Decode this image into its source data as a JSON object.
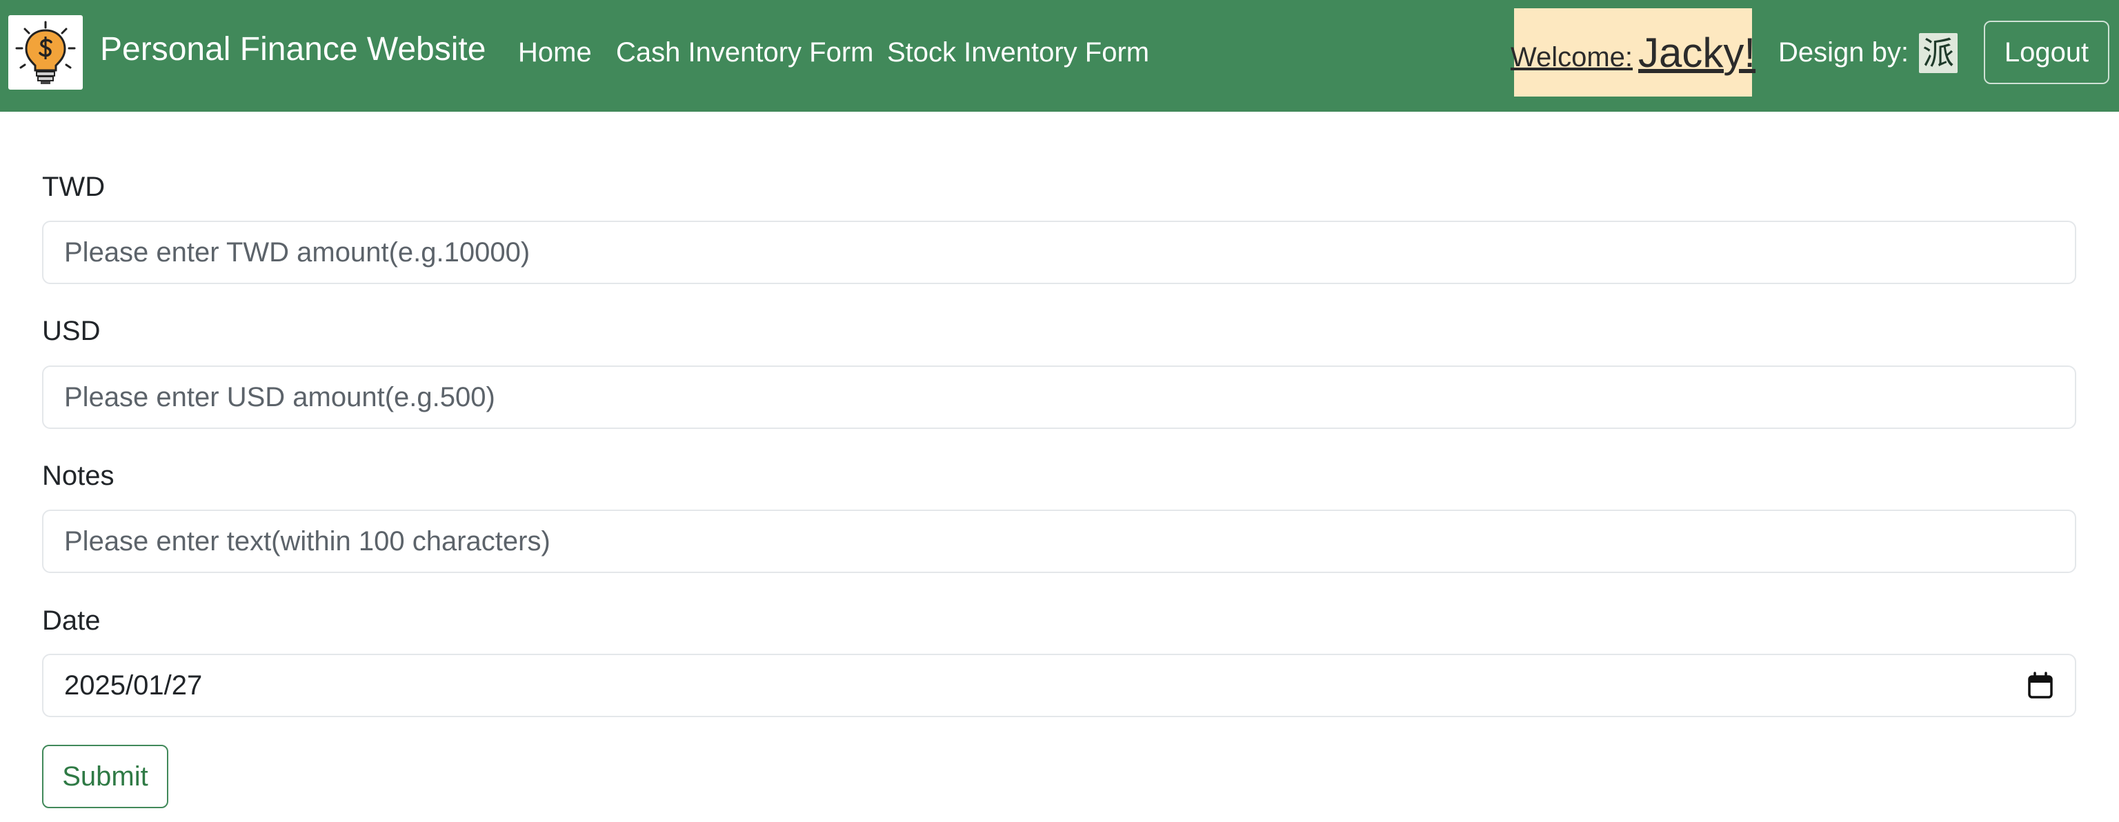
{
  "navbar": {
    "brand_title": "Personal Finance Website",
    "logo_icon": "lightbulb-dollar-icon",
    "links": {
      "home": "Home",
      "cash": "Cash Inventory Form",
      "stock": "Stock Inventory Form"
    },
    "welcome_label": "Welcome:",
    "welcome_name": "Jacky!",
    "design_by": "Design by:",
    "designer_glyph": "派",
    "logout": "Logout",
    "colors": {
      "background": "#41895a",
      "welcome_bg": "#fde8c0"
    }
  },
  "form": {
    "twd": {
      "label": "TWD",
      "placeholder": "Please enter TWD amount(e.g.10000)",
      "value": ""
    },
    "usd": {
      "label": "USD",
      "placeholder": "Please enter USD amount(e.g.500)",
      "value": ""
    },
    "notes": {
      "label": "Notes",
      "placeholder": "Please enter text(within 100 characters)",
      "value": ""
    },
    "date": {
      "label": "Date",
      "value": "2025/01/27",
      "icon": "calendar-icon"
    },
    "submit": "Submit"
  }
}
